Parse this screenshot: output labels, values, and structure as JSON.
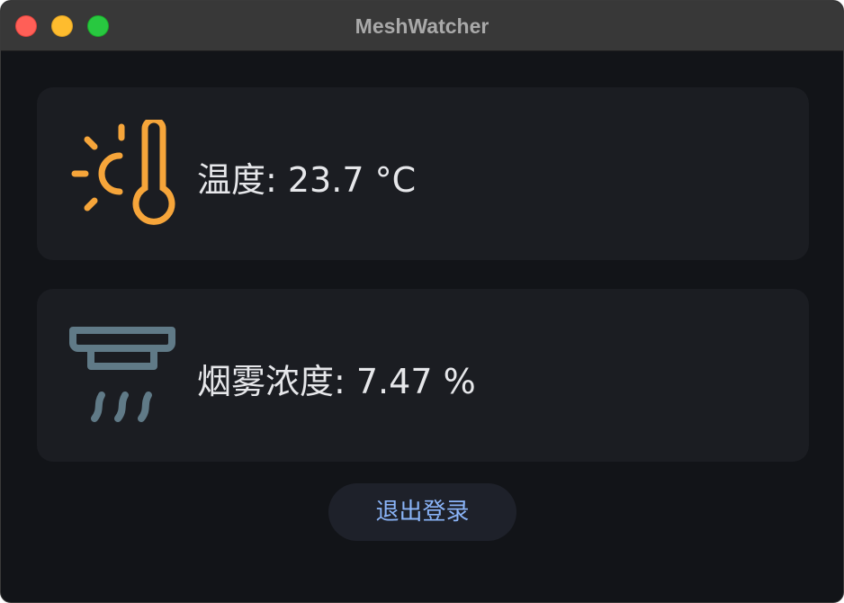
{
  "window": {
    "title": "MeshWatcher"
  },
  "temperature": {
    "label": "温度",
    "value": "23.7",
    "unit": "°C",
    "text": "温度: 23.7 °C",
    "icon": "temperature-sun-icon",
    "icon_color": "#f6a53a"
  },
  "smoke": {
    "label": "烟雾浓度",
    "value": "7.47",
    "unit": "%",
    "text": "烟雾浓度: 7.47 %",
    "icon": "smoke-detector-icon",
    "icon_color": "#607a87"
  },
  "actions": {
    "logout_label": "退出登录"
  },
  "colors": {
    "background": "#121418",
    "card": "#1b1d22",
    "accent": "#8ab4f8",
    "text": "#e6e7ea"
  }
}
